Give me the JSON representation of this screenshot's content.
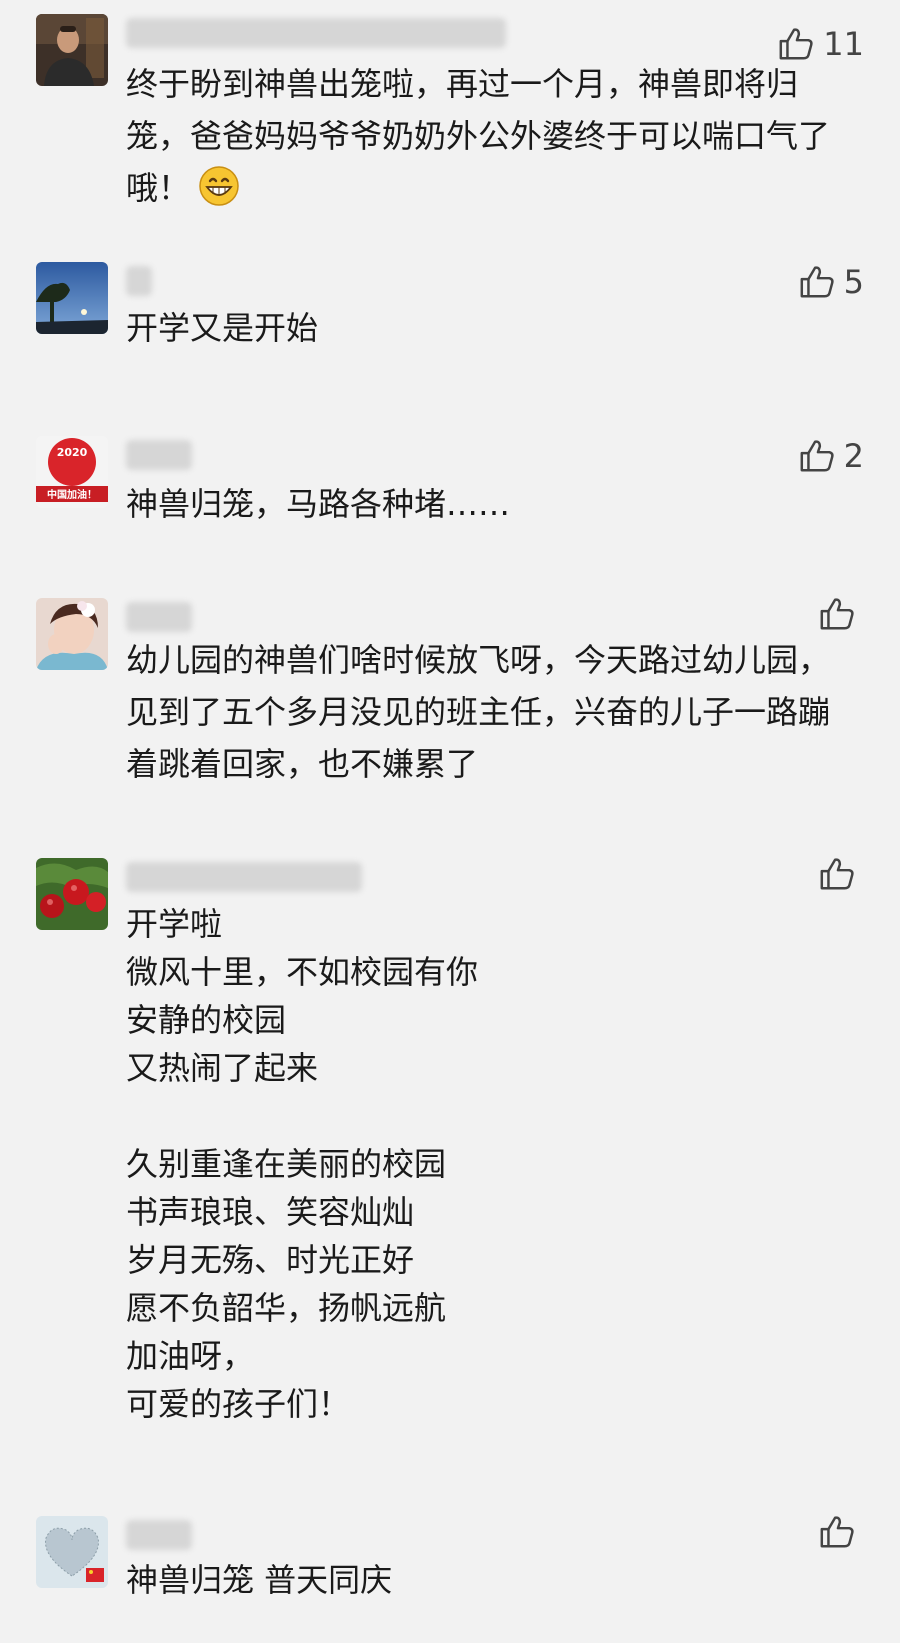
{
  "comments": [
    {
      "name": "",
      "likes": "11",
      "text": "终于盼到神兽出笼啦，再过一个月，神兽即将归笼，爸爸妈妈爷爷奶奶外公外婆终于可以喘口气了哦！",
      "emoji": "grinning-face-icon"
    },
    {
      "name": "",
      "likes": "5",
      "text": "开学又是开始"
    },
    {
      "name": "",
      "likes": "2",
      "text": "神兽归笼，马路各种堵……",
      "avatar_text": {
        "line1": "2020",
        "line2": "中国加油！"
      }
    },
    {
      "name": "",
      "likes": "",
      "text": "幼儿园的神兽们啥时候放飞呀，今天路过幼儿园，见到了五个多月没见的班主任，兴奋的儿子一路蹦着跳着回家，也不嫌累了"
    },
    {
      "name": "",
      "likes": "",
      "text": "开学啦\n微风十里，不如校园有你\n安静的校园\n又热闹了起来\n\n久别重逢在美丽的校园\n书声琅琅、笑容灿灿\n岁月无殇、时光正好\n愿不负韶华，扬帆远航\n加油呀，\n可爱的孩子们！"
    },
    {
      "name": "",
      "likes": "",
      "text": "神兽归笼 普天同庆"
    }
  ],
  "colors": {
    "background": "#f2f2f2",
    "text": "#1a1a1a",
    "like_icon": "#444444"
  },
  "icons": {
    "like": "thumbs-up-icon"
  }
}
